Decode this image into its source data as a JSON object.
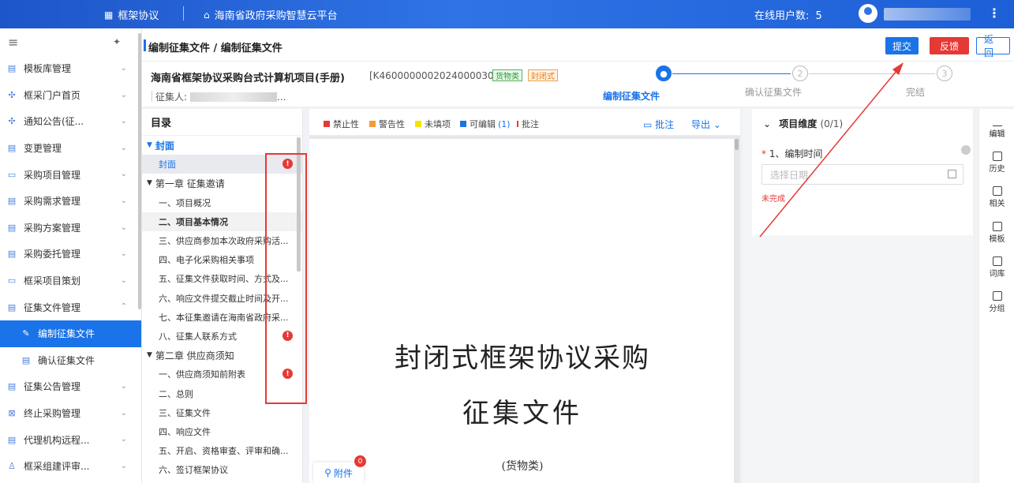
{
  "topbar": {
    "brand": "框架协议",
    "platform": "海南省政府采购智慧云平台",
    "online_label": "在线用户数:",
    "online_count": "5"
  },
  "sidebar": {
    "items": [
      {
        "label": "模板库管理",
        "icon": "doc-icon"
      },
      {
        "label": "框采门户首页",
        "icon": "grid-icon"
      },
      {
        "label": "通知公告(征...",
        "icon": "grid-icon"
      },
      {
        "label": "变更管理",
        "icon": "doc-icon"
      },
      {
        "label": "采购项目管理",
        "icon": "folder-icon"
      },
      {
        "label": "采购需求管理",
        "icon": "doc-icon"
      },
      {
        "label": "采购方案管理",
        "icon": "doc-icon"
      },
      {
        "label": "采购委托管理",
        "icon": "doc-icon"
      },
      {
        "label": "框采项目策划",
        "icon": "folder-icon"
      },
      {
        "label": "征集文件管理",
        "icon": "doc-icon"
      },
      {
        "label": "编制征集文件",
        "icon": "edit-doc-icon"
      },
      {
        "label": "确认征集文件",
        "icon": "check-doc-icon"
      },
      {
        "label": "征集公告管理",
        "icon": "doc-icon"
      },
      {
        "label": "终止采购管理",
        "icon": "stop-icon"
      },
      {
        "label": "代理机构远程...",
        "icon": "doc-icon"
      },
      {
        "label": "框采组建评审...",
        "icon": "user-icon"
      }
    ]
  },
  "header": {
    "title": "编制征集文件 / 编制征集文件",
    "submit": "提交",
    "feedback": "反馈",
    "back": "返回"
  },
  "project": {
    "name": "海南省框架协议采购台式计算机项目(手册)",
    "code": "[K4600000002024000030]",
    "tag1": "货物类",
    "tag2": "封闭式",
    "collector_label": "征集人:",
    "collector_suffix": "..."
  },
  "steps": [
    {
      "num": "1",
      "label": "编制征集文件"
    },
    {
      "num": "2",
      "label": "确认征集文件"
    },
    {
      "num": "3",
      "label": "完结"
    }
  ],
  "toc": {
    "title": "目录",
    "items": [
      {
        "label": "封面"
      },
      {
        "label": "封面"
      },
      {
        "label": "第一章 征集邀请"
      },
      {
        "label": "一、项目概况"
      },
      {
        "label": "二、项目基本情况"
      },
      {
        "label": "三、供应商参加本次政府采购活..."
      },
      {
        "label": "四、电子化采购相关事项"
      },
      {
        "label": "五、征集文件获取时间、方式及..."
      },
      {
        "label": "六、响应文件提交截止时间及开..."
      },
      {
        "label": "七、本征集邀请在海南省政府采..."
      },
      {
        "label": "八、征集人联系方式"
      },
      {
        "label": "第二章 供应商须知"
      },
      {
        "label": "一、供应商须知前附表"
      },
      {
        "label": "二、总则"
      },
      {
        "label": "三、征集文件"
      },
      {
        "label": "四、响应文件"
      },
      {
        "label": "五、开启、资格审查、评审和确..."
      },
      {
        "label": "六、签订框架协议"
      }
    ],
    "error_mark": "!"
  },
  "docbar": {
    "legend": [
      {
        "label": "禁止性",
        "color": "#e53935"
      },
      {
        "label": "警告性",
        "color": "#f39c3c"
      },
      {
        "label": "未填项",
        "color": "#f5e400"
      },
      {
        "label": "可编辑",
        "color": "#1a73e8"
      },
      {
        "label": "批注",
        "color": "#e53935"
      }
    ],
    "editable_count": "(1)",
    "annotate": "批注",
    "export": "导出"
  },
  "document": {
    "line1": "封闭式框架协议采购",
    "line2": "征集文件",
    "line3": "(货物类)"
  },
  "attachment": {
    "label": "附件",
    "badge": "0"
  },
  "form": {
    "section": "项目维度",
    "section_count": "(0/1)",
    "field_label": "1、编制时间",
    "required_mark": "*",
    "date_placeholder": "选择日期",
    "status": "未完成"
  },
  "toolbar": {
    "edit": "编辑",
    "history": "历史",
    "related": "相关",
    "template": "模板",
    "lexicon": "词库",
    "group": "分组"
  }
}
